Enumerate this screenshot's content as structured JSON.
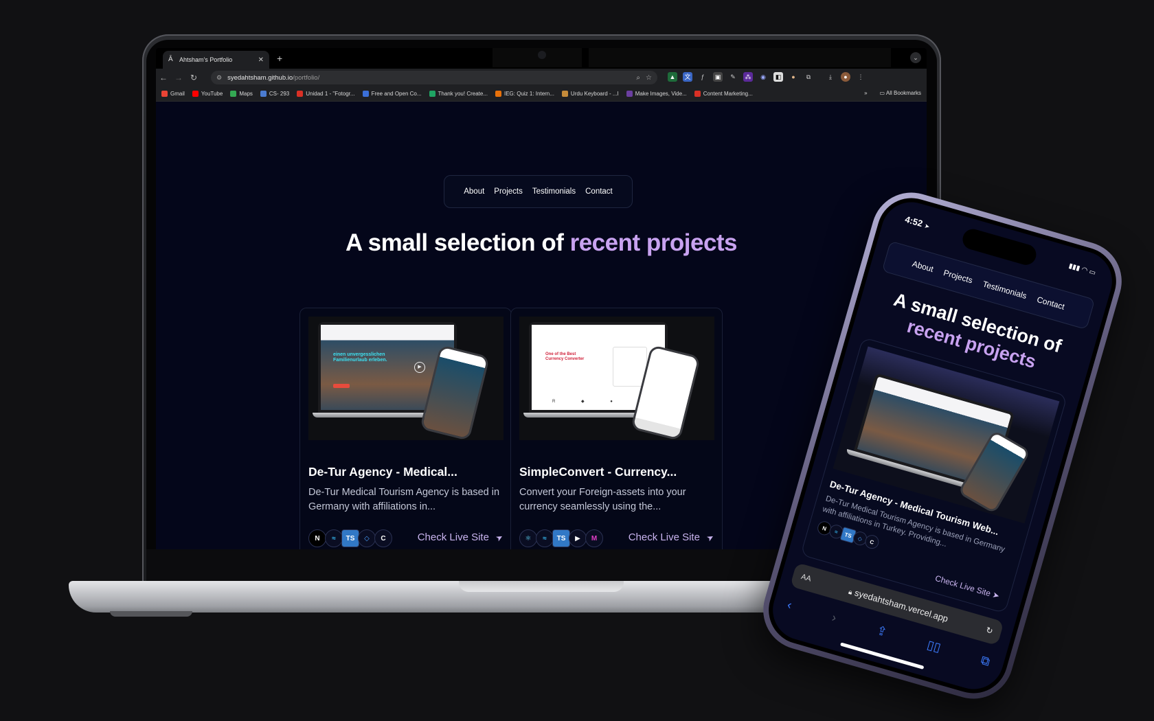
{
  "browser": {
    "tab_title": "Ahtsham's Portfolio",
    "url_host": "syedahtsham.github.io",
    "url_path": "/portfolio/",
    "bookmarks": [
      {
        "label": "Gmail",
        "color": "#ea4335"
      },
      {
        "label": "YouTube",
        "color": "#ff0000"
      },
      {
        "label": "Maps",
        "color": "#34a853"
      },
      {
        "label": "CS- 293",
        "color": "#4a7bd0"
      },
      {
        "label": "Unidad 1 - \"Fotogr...",
        "color": "#d93025"
      },
      {
        "label": "Free and Open Co...",
        "color": "#3b6fd8"
      },
      {
        "label": "Thank you! Create...",
        "color": "#1fa463"
      },
      {
        "label": "IEG: Quiz 1: Intern...",
        "color": "#e8710a"
      },
      {
        "label": "Urdu Keyboard - ...ا",
        "color": "#c58b3a"
      },
      {
        "label": "Make Images, Vide...",
        "color": "#6b3fa0"
      },
      {
        "label": "Content Marketing...",
        "color": "#d93025"
      }
    ],
    "all_bookmarks": "All Bookmarks",
    "overflow": "»"
  },
  "site": {
    "nav": [
      "About",
      "Projects",
      "Testimonials",
      "Contact"
    ],
    "headline_plain": "A small selection of ",
    "headline_accent": "recent projects",
    "accent_color": "#c8a2f0",
    "cta_label": "Check Live Site",
    "projects": [
      {
        "title": "De-Tur Agency - Medical...",
        "description": "De-Tur Medical Tourism Agency is based in Germany with affiliations in...",
        "stack": [
          "N",
          "≈",
          "TS",
          "◇",
          "C"
        ],
        "thumb_headline": "einen unvergesslichen Familienurlaub erleben."
      },
      {
        "title": "SimpleConvert - Currency...",
        "description": "Convert your Foreign-assets into your currency seamlessly using the...",
        "stack": [
          "⚛",
          "≈",
          "TS",
          "▶",
          "M"
        ],
        "thumb_headline": "One of the Best Currency Converter"
      }
    ]
  },
  "phone": {
    "time": "4:52",
    "nav": [
      "About",
      "Projects",
      "Testimonials",
      "Contact"
    ],
    "headline_plain": "A small selection of",
    "headline_accent": "recent projects",
    "card_title": "De-Tur Agency - Medical Tourism Web...",
    "card_desc": "De-Tur Medical Tourism Agency is based in Germany with affiliations in Turkey. Providing...",
    "cta_label": "Check Live Site",
    "url": "syedahtsham.vercel.app",
    "aa": "AA"
  }
}
